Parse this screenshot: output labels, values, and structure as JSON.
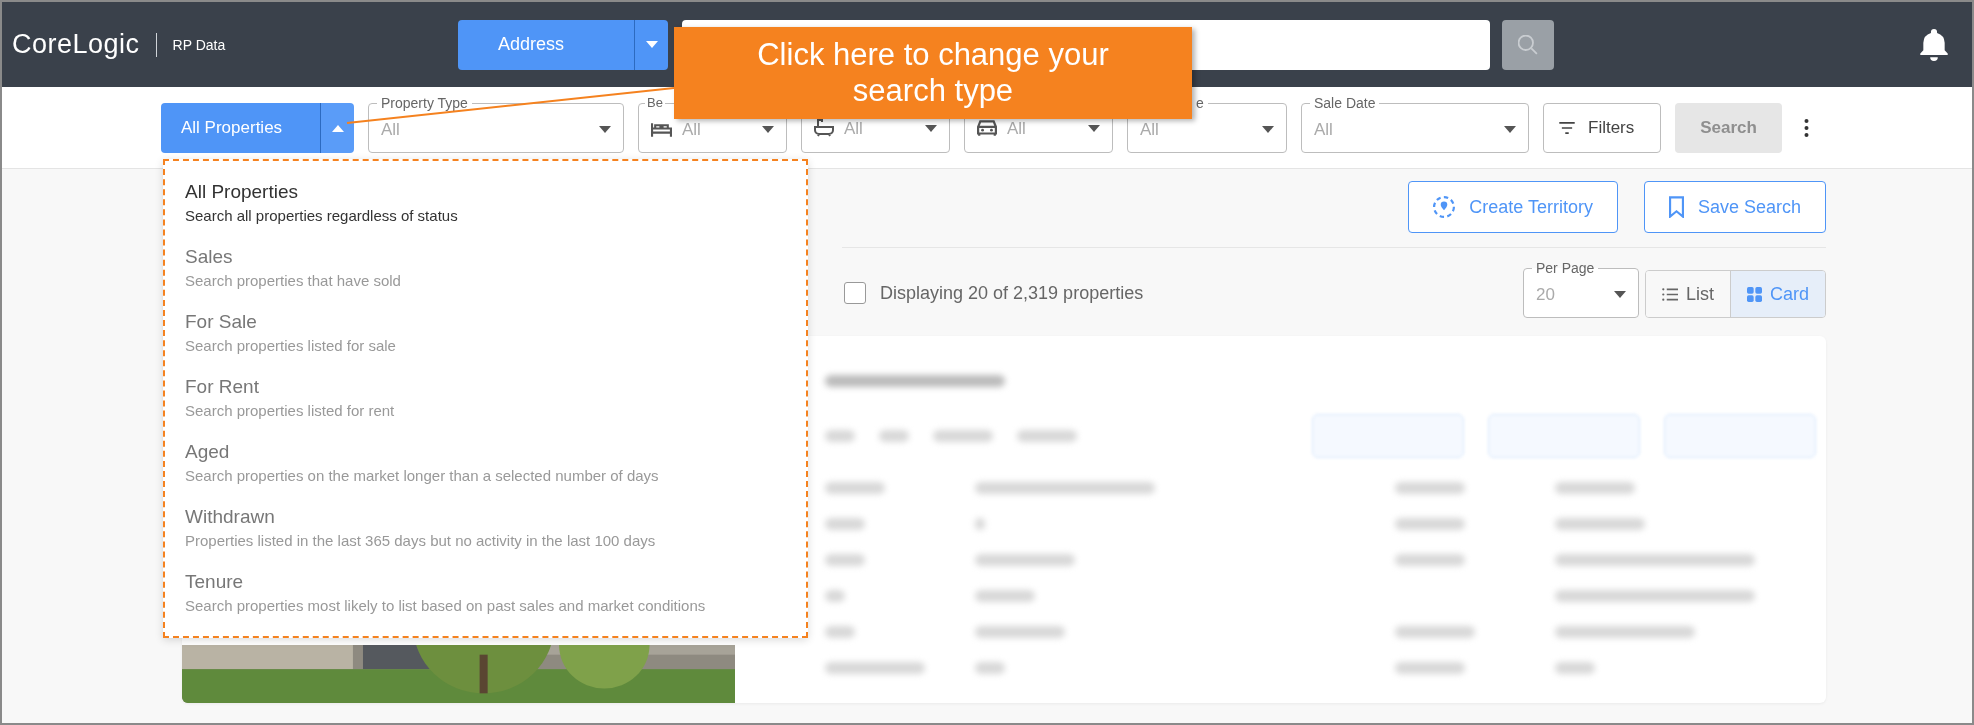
{
  "header": {
    "logo": "CoreLogic",
    "product": "RP Data",
    "search_type": "Address"
  },
  "filters": {
    "type_button": "All Properties",
    "menu_open": true,
    "fields": [
      {
        "kind": "select",
        "label": "Property Type",
        "value": "All"
      },
      {
        "kind": "bed",
        "label": "Be",
        "value": "All"
      },
      {
        "kind": "bath",
        "value": "All"
      },
      {
        "kind": "car",
        "value": "All"
      },
      {
        "kind": "select",
        "label": "e",
        "value": "All"
      },
      {
        "kind": "select",
        "label": "Sale Date",
        "value": "All"
      }
    ],
    "filters_button": "Filters",
    "search_button": {
      "label": "Search",
      "disabled": true
    }
  },
  "search_type_menu": [
    {
      "title": "All Properties",
      "description": "Search all properties regardless of status",
      "selected": true
    },
    {
      "title": "Sales",
      "description": "Search properties that have sold",
      "selected": false
    },
    {
      "title": "For Sale",
      "description": "Search properties listed for sale",
      "selected": false
    },
    {
      "title": "For Rent",
      "description": "Search properties listed for rent",
      "selected": false
    },
    {
      "title": "Aged",
      "description": "Search properties on the market longer than a selected number of days",
      "selected": false
    },
    {
      "title": "Withdrawn",
      "description": "Properties listed in the last 365 days but no activity in the last 100 days",
      "selected": false
    },
    {
      "title": "Tenure",
      "description": "Search properties most likely to list based on past sales and market conditions",
      "selected": false
    }
  ],
  "callout": "Click here to change your search type",
  "actions": [
    {
      "kind": "territory",
      "label": "Create Territory"
    },
    {
      "kind": "bookmark",
      "label": "Save Search"
    }
  ],
  "results": {
    "select_all_checked": false,
    "summary": "Displaying 20 of 2,319 properties",
    "per_page": {
      "label": "Per Page",
      "value": "20"
    },
    "views": [
      {
        "kind": "list",
        "label": "List",
        "selected": false
      },
      {
        "kind": "grid",
        "label": "Card",
        "selected": true
      }
    ]
  }
}
